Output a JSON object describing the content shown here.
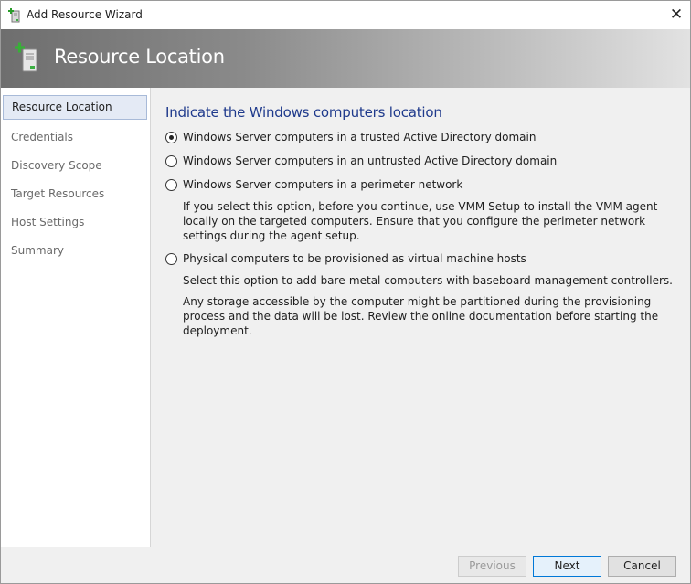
{
  "window": {
    "title": "Add Resource Wizard",
    "close_glyph": "✕"
  },
  "banner": {
    "title": "Resource Location",
    "icon": "add-server-icon"
  },
  "nav": {
    "items": [
      {
        "label": "Resource Location",
        "active": true
      },
      {
        "label": "Credentials"
      },
      {
        "label": "Discovery Scope"
      },
      {
        "label": "Target Resources"
      },
      {
        "label": "Host Settings"
      },
      {
        "label": "Summary"
      }
    ]
  },
  "main": {
    "heading": "Indicate the Windows computers location",
    "options": [
      {
        "label": "Windows Server computers in a trusted Active Directory domain",
        "selected": true
      },
      {
        "label": "Windows Server computers in an untrusted Active Directory domain",
        "selected": false
      },
      {
        "label": "Windows Server computers in a perimeter network",
        "selected": false,
        "description": "If you select this option, before you continue, use VMM Setup to install the VMM agent locally on the targeted computers. Ensure that you configure the perimeter network settings during the agent setup."
      },
      {
        "label": "Physical computers to be provisioned as virtual machine hosts",
        "selected": false,
        "description": "Select this option to add bare-metal computers with baseboard management controllers.",
        "description2": "Any storage accessible by the computer might be partitioned during the provisioning process and the data will be lost. Review the online documentation before starting the deployment."
      }
    ]
  },
  "footer": {
    "previous_label": "Previous",
    "next_label": "Next",
    "cancel_label": "Cancel"
  }
}
